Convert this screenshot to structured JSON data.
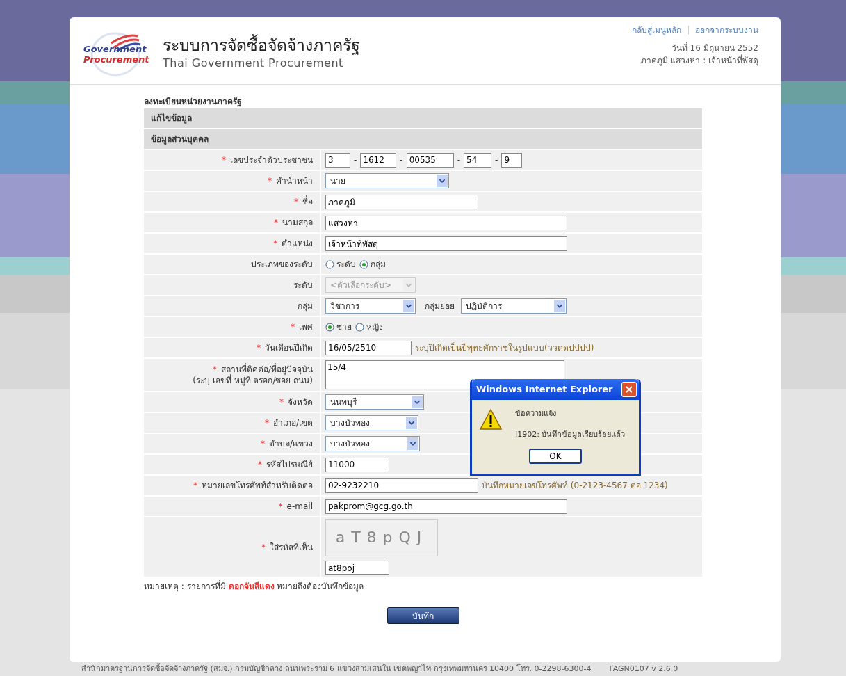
{
  "header": {
    "logo": {
      "line1": "Government",
      "line2": "Procurement"
    },
    "title": "ระบบการจัดซื้อจัดจ้างภาครัฐ",
    "subtitle": "Thai Government Procurement",
    "links": [
      "กลับสู่เมนูหลัก",
      "ออกจากระบบงาน"
    ],
    "link_separator": "|",
    "date": "วันที่ 16 มิถุนายน 2552",
    "user": "ภาคภูมิ แสวงหา : เจ้าหน้าที่พัสดุ"
  },
  "form": {
    "required_mark": "*",
    "page_title": "ลงทะเบียนหน่วยงานภาครัฐ",
    "sections": [
      "แก้ไขข้อมูล",
      "ข้อมูลส่วนบุคคล"
    ],
    "rows": [
      {
        "kind": "segments",
        "label": "เลขประจำตัวประชาชน",
        "required": true,
        "separator": "-",
        "values": [
          "3",
          "1612",
          "00535",
          "54",
          "9"
        ]
      },
      {
        "kind": "select",
        "label": "คำนำหน้า",
        "required": true,
        "value": "นาย",
        "disabled": false
      },
      {
        "kind": "text",
        "label": "ชื่อ",
        "required": true,
        "value": "ภาคภูมิ"
      },
      {
        "kind": "text",
        "label": "นามสกุล",
        "required": true,
        "value": "แสวงหา"
      },
      {
        "kind": "text",
        "label": "ตำแหน่ง",
        "required": true,
        "value": "เจ้าหน้าที่พัสดุ"
      },
      {
        "kind": "radio",
        "label": "ประเภทของระดับ",
        "required": false,
        "options": [
          {
            "label": "ระดับ",
            "selected": false
          },
          {
            "label": "กลุ่ม",
            "selected": true
          }
        ]
      },
      {
        "kind": "select",
        "label": "ระดับ",
        "required": false,
        "placeholder": "<ตัวเลือกระดับ>",
        "disabled": true
      },
      {
        "kind": "select_pair",
        "label": "กลุ่ม",
        "required": false,
        "value": "วิชาการ",
        "label2": "กลุ่มย่อย",
        "value2": "ปฏิบัติการ"
      },
      {
        "kind": "radio",
        "label": "เพศ",
        "required": true,
        "options": [
          {
            "label": "ชาย",
            "selected": true
          },
          {
            "label": "หญิง",
            "selected": false
          }
        ]
      },
      {
        "kind": "text",
        "label": "วันเดือนปีเกิด",
        "required": true,
        "value": "16/05/2510",
        "hint": "ระบุปีเกิดเป็นปีพุทธศักราชในรูปแบบ(ววดดปปปป)"
      },
      {
        "kind": "textarea",
        "label": "สถานที่ติดต่อ/ที่อยู่ปัจจุบัน",
        "label2": "(ระบุ เลขที่ หมู่ที่ ตรอก/ซอย ถนน)",
        "required": true,
        "value": "15/4"
      },
      {
        "kind": "select",
        "label": "จังหวัด",
        "required": true,
        "value": "นนทบุรี",
        "disabled": false
      },
      {
        "kind": "select",
        "label": "อำเภอ/เขต",
        "required": true,
        "value": "บางบัวทอง",
        "disabled": false
      },
      {
        "kind": "select",
        "label": "ตำบล/แขวง",
        "required": true,
        "value": "บางบัวทอง",
        "disabled": false
      },
      {
        "kind": "text",
        "label": "รหัสไปรษณีย์",
        "required": true,
        "value": "11000"
      },
      {
        "kind": "text",
        "label": "หมายเลขโทรศัพท์สำหรับติดต่อ",
        "required": true,
        "value": "02-9232210",
        "hint": "บันทึกหมายเลขโทรศัพท์ (0-2123-4567 ต่อ 1234)"
      },
      {
        "kind": "text",
        "label": "e-mail",
        "required": true,
        "value": "pakprom@gcg.go.th"
      },
      {
        "kind": "captcha",
        "label": "ใส่รหัสที่เห็น",
        "required": true,
        "code": "aT8pQJ",
        "value": "at8poj"
      }
    ],
    "note": {
      "prefix": "หมายเหตุ : รายการที่มี",
      "highlight": "ดอกจันสีแดง",
      "suffix": "หมายถึงต้องบันทึกข้อมูล"
    },
    "save_button": "บันทึก"
  },
  "dialog": {
    "title": "Windows Internet Explorer",
    "heading": "ข้อความแจ้ง",
    "message": "I1902: บันทึกข้อมูลเรียบร้อยแล้ว",
    "button": "OK"
  },
  "footer": {
    "address": "สำนักมาตรฐานการจัดซื้อจัดจ้างภาครัฐ (สมจ.) กรมบัญชีกลาง ถนนพระราม 6 แขวงสามเสนใน เขตพญาไท กรุงเทพมหานคร 10400 โทร. 0-2298-6300-4",
    "version": "FAGN0107 v 2.6.0"
  }
}
